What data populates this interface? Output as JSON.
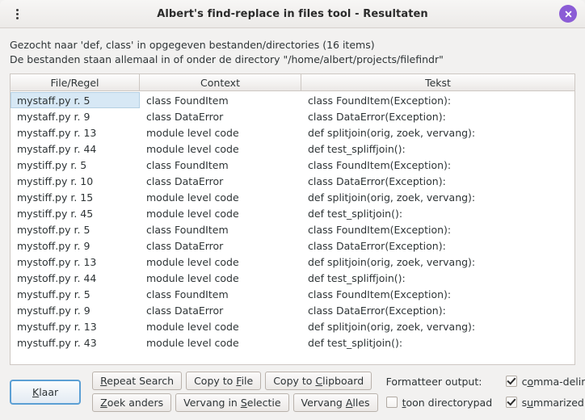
{
  "window": {
    "title": "Albert's find-replace in files tool - Resultaten",
    "menu_icon": "vertical-ellipsis-icon",
    "close_icon": "close-icon",
    "close_color": "#8b5cd6"
  },
  "info": {
    "line1": "Gezocht naar 'def, class' in opgegeven bestanden/directories (16 items)",
    "line2": "De bestanden staan allemaal in of onder de directory \"/home/albert/projects/filefindr\""
  },
  "table": {
    "columns": [
      "File/Regel",
      "Context",
      "Tekst"
    ],
    "selected_row": 0,
    "rows": [
      {
        "file": "mystaff.py r. 5",
        "context": "class FoundItem",
        "text": "class FoundItem(Exception):"
      },
      {
        "file": "mystaff.py r. 9",
        "context": "class DataError",
        "text": "class DataError(Exception):"
      },
      {
        "file": "mystaff.py r. 13",
        "context": "module level code",
        "text": "def splitjoin(orig, zoek, vervang):"
      },
      {
        "file": "mystaff.py r. 44",
        "context": "module level code",
        "text": "def test_spliffjoin():"
      },
      {
        "file": "mystiff.py r. 5",
        "context": "class FoundItem",
        "text": "class FoundItem(Exception):"
      },
      {
        "file": "mystiff.py r. 10",
        "context": "class DataError",
        "text": "class DataError(Exception):"
      },
      {
        "file": "mystiff.py r. 15",
        "context": "module level code",
        "text": "def splitjoin(orig, zoek, vervang):"
      },
      {
        "file": "mystiff.py r. 45",
        "context": "module level code",
        "text": "def test_splitjoin():"
      },
      {
        "file": "mystoff.py r. 5",
        "context": "class FoundItem",
        "text": "class FoundItem(Exception):"
      },
      {
        "file": "mystoff.py r. 9",
        "context": "class DataError",
        "text": "class DataError(Exception):"
      },
      {
        "file": "mystoff.py r. 13",
        "context": "module level code",
        "text": "def splitjoin(orig, zoek, vervang):"
      },
      {
        "file": "mystoff.py r. 44",
        "context": "module level code",
        "text": "def test_spliffjoin():"
      },
      {
        "file": "mystuff.py r. 5",
        "context": "class FoundItem",
        "text": "class FoundItem(Exception):"
      },
      {
        "file": "mystuff.py r. 9",
        "context": "class DataError",
        "text": "class DataError(Exception):"
      },
      {
        "file": "mystuff.py r. 13",
        "context": "module level code",
        "text": "def splitjoin(orig, zoek, vervang):"
      },
      {
        "file": "mystuff.py r. 43",
        "context": "module level code",
        "text": "def test_splitjoin():"
      }
    ]
  },
  "actions": {
    "done": {
      "pre": "",
      "mnemonic": "K",
      "post": "laar"
    },
    "repeat_search": {
      "pre": "",
      "mnemonic": "R",
      "post": "epeat Search"
    },
    "copy_to_file": {
      "pre": "Copy to ",
      "mnemonic": "F",
      "post": "ile"
    },
    "copy_to_clipboard": {
      "pre": "Copy to ",
      "mnemonic": "C",
      "post": "lipboard"
    },
    "search_other": {
      "pre": "",
      "mnemonic": "Z",
      "post": "oek anders"
    },
    "replace_selection": {
      "pre": "Vervang in ",
      "mnemonic": "S",
      "post": "electie"
    },
    "replace_all": {
      "pre": "Vervang ",
      "mnemonic": "A",
      "post": "lles"
    }
  },
  "options": {
    "format_label": "Formatteer output:",
    "comma_delimited": {
      "pre": "c",
      "mnemonic": "o",
      "post": "mma-delimited",
      "checked": true
    },
    "show_dirpath": {
      "pre": "",
      "mnemonic": "t",
      "post": "oon directorypad",
      "checked": false
    },
    "summarized": {
      "pre": "s",
      "mnemonic": "u",
      "post": "mmarized",
      "checked": true
    }
  }
}
